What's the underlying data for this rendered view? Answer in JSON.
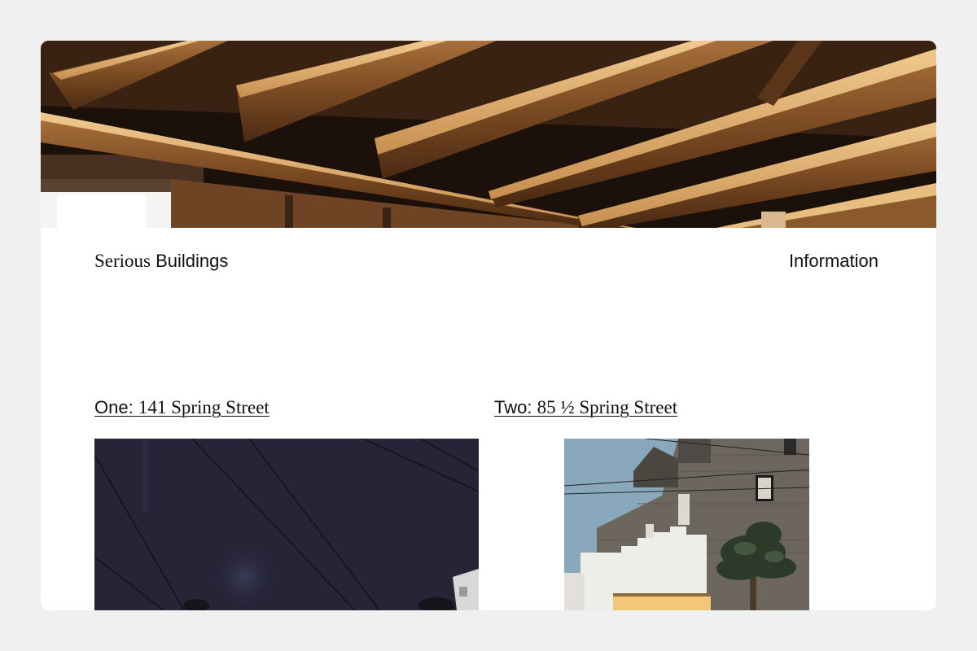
{
  "header": {
    "brand_serif": "Serious",
    "brand_sans": "Buildings",
    "nav_information": "Information"
  },
  "hero": {
    "image": "roof-rafters-photo"
  },
  "projects": [
    {
      "number": "One:",
      "address": "141 Spring Street",
      "image": "night-street-photo"
    },
    {
      "number": "Two:",
      "address": "85 ½ Spring Street",
      "image": "house-facade-photo"
    }
  ],
  "colors": {
    "page_background": "#f0f0f0",
    "card_background": "#ffffff",
    "text": "#111111"
  }
}
